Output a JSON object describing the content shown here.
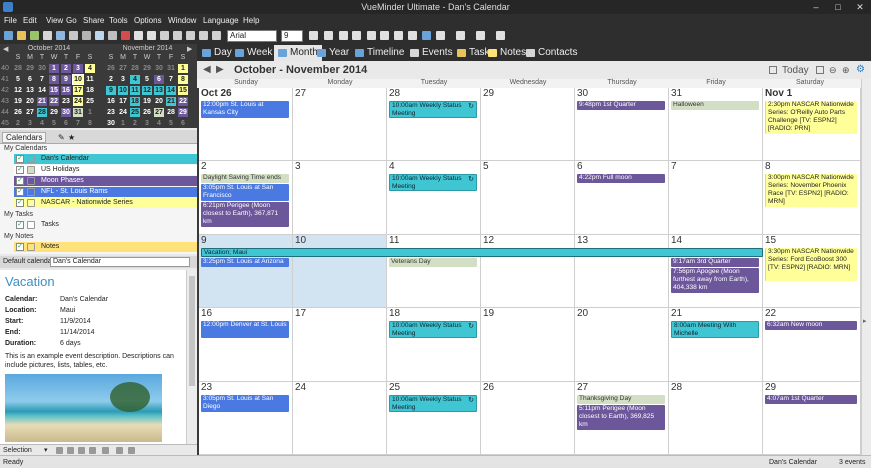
{
  "window": {
    "title": "VueMinder Ultimate - Dan's Calendar"
  },
  "menu": [
    "File",
    "Edit",
    "View",
    "Go",
    "Share",
    "Tools",
    "Options",
    "Window",
    "Language",
    "Help"
  ],
  "toolbar": {
    "font_name": "Arial",
    "font_size": "9"
  },
  "mini_calendars": [
    {
      "title": "October 2014",
      "headers": [
        "S",
        "M",
        "T",
        "W",
        "T",
        "F",
        "S"
      ],
      "rows": [
        {
          "wk": "40",
          "days": [
            "28",
            "29",
            "30",
            "1",
            "2",
            "3",
            "4"
          ]
        },
        {
          "wk": "41",
          "days": [
            "5",
            "6",
            "7",
            "8",
            "9",
            "10",
            "11"
          ]
        },
        {
          "wk": "42",
          "days": [
            "12",
            "13",
            "14",
            "15",
            "16",
            "17",
            "18"
          ]
        },
        {
          "wk": "43",
          "days": [
            "19",
            "20",
            "21",
            "22",
            "23",
            "24",
            "25"
          ]
        },
        {
          "wk": "44",
          "days": [
            "26",
            "27",
            "28",
            "29",
            "30",
            "31",
            "1"
          ]
        },
        {
          "wk": "45",
          "days": [
            "2",
            "3",
            "4",
            "5",
            "6",
            "7",
            "8"
          ]
        }
      ]
    },
    {
      "title": "November 2014",
      "headers": [
        "S",
        "M",
        "T",
        "W",
        "T",
        "F",
        "S"
      ],
      "rows": [
        {
          "wk": "",
          "days": [
            "26",
            "27",
            "28",
            "29",
            "30",
            "31",
            "1"
          ]
        },
        {
          "wk": "",
          "days": [
            "2",
            "3",
            "4",
            "5",
            "6",
            "7",
            "8"
          ]
        },
        {
          "wk": "",
          "days": [
            "9",
            "10",
            "11",
            "12",
            "13",
            "14",
            "15"
          ]
        },
        {
          "wk": "",
          "days": [
            "16",
            "17",
            "18",
            "19",
            "20",
            "21",
            "22"
          ]
        },
        {
          "wk": "",
          "days": [
            "23",
            "24",
            "25",
            "26",
            "27",
            "28",
            "29"
          ]
        },
        {
          "wk": "",
          "days": [
            "30",
            "1",
            "2",
            "3",
            "4",
            "5",
            "6"
          ]
        }
      ]
    }
  ],
  "calendars_panel": {
    "tab": "Calendars",
    "groups": [
      {
        "label": "My Calendars",
        "items": [
          {
            "label": "Dan's Calendar",
            "color": "#3fc6d2"
          },
          {
            "label": "US Holidays",
            "color": "#d3dfc4"
          },
          {
            "label": "Moon Phases",
            "color": "#6c579a"
          },
          {
            "label": "NFL - St. Louis Rams",
            "color": "#4a79e2"
          },
          {
            "label": "NASCAR - Nationwide Series",
            "color": "#ffff99"
          }
        ]
      },
      {
        "label": "My Tasks",
        "items": [
          {
            "label": "Tasks",
            "color": "#ffffff"
          }
        ]
      },
      {
        "label": "My Notes",
        "items": [
          {
            "label": "Notes",
            "color": "#ffe27a"
          }
        ]
      }
    ],
    "default_label": "Default calendar:",
    "default_value": "Dan's Calendar"
  },
  "details": {
    "heading": "Vacation",
    "fields": [
      {
        "k": "Calendar:",
        "v": "Dan's Calendar"
      },
      {
        "k": "Location:",
        "v": "Maui"
      },
      {
        "k": "Start:",
        "v": "11/9/2014"
      },
      {
        "k": "End:",
        "v": "11/14/2014"
      },
      {
        "k": "Duration:",
        "v": "6 days"
      }
    ],
    "description": "This is an example event description. Descriptions can include pictures, lists, tables, etc."
  },
  "selection_label": "Selection",
  "views": [
    "Day",
    "Week",
    "Month",
    "Year",
    "Timeline",
    "Events",
    "Tasks",
    "Notes",
    "Contacts"
  ],
  "active_view": "Month",
  "nav": {
    "range": "October - November 2014",
    "today": "Today"
  },
  "day_names": [
    "Sunday",
    "Monday",
    "Tuesday",
    "Wednesday",
    "Thursday",
    "Friday",
    "Saturday"
  ],
  "weeks": [
    {
      "days": [
        {
          "n": "Oct 26",
          "bold": true,
          "events": [
            {
              "t": "12:00pm St. Louis at Kansas City",
              "c": "blue",
              "h": 2
            }
          ]
        },
        {
          "n": "27",
          "events": []
        },
        {
          "n": "28",
          "events": [
            {
              "t": "10:00am Weekly Status Meeting",
              "c": "teal",
              "h": 2,
              "rec": true
            }
          ]
        },
        {
          "n": "29",
          "events": []
        },
        {
          "n": "30",
          "events": [
            {
              "t": "9:48pm 1st Quarter",
              "c": "purple",
              "h": 1
            }
          ]
        },
        {
          "n": "31",
          "events": [
            {
              "t": "Halloween",
              "c": "green",
              "h": 1
            }
          ]
        },
        {
          "n": "Nov 1",
          "bold": true,
          "events": [
            {
              "t": "2:30pm NASCAR Nationwide Series: O'Reilly Auto Parts Challenge [TV: ESPN2] [RADIO: PRN]",
              "c": "yellow",
              "h": 4
            }
          ]
        }
      ]
    },
    {
      "days": [
        {
          "n": "2",
          "events": [
            {
              "t": "Daylight Saving Time ends",
              "c": "green",
              "h": 1
            },
            {
              "t": "3:05pm St. Louis at San Francisco",
              "c": "blue",
              "h": 2
            },
            {
              "t": "6:21pm Perigee (Moon closest to Earth), 367,871 km",
              "c": "purple",
              "h": 3
            }
          ]
        },
        {
          "n": "3",
          "events": []
        },
        {
          "n": "4",
          "events": [
            {
              "t": "10:00am Weekly Status Meeting",
              "c": "teal",
              "h": 2,
              "rec": true
            }
          ]
        },
        {
          "n": "5",
          "events": []
        },
        {
          "n": "6",
          "events": [
            {
              "t": "4:22pm Full moon",
              "c": "purple",
              "h": 1
            }
          ]
        },
        {
          "n": "7",
          "events": []
        },
        {
          "n": "8",
          "events": [
            {
              "t": "3:00pm NASCAR Nationwide Series: November Phoenix Race [TV: ESPN2] [RADIO: MRN]",
              "c": "yellow",
              "h": 4
            }
          ]
        }
      ]
    },
    {
      "days": [
        {
          "n": "9",
          "hl": true,
          "events": [
            {
              "t": "",
              "c": "spacer",
              "h": 1
            },
            {
              "t": "3:25pm St. Louis at Arizona",
              "c": "blue",
              "h": 1
            }
          ]
        },
        {
          "n": "10",
          "hl": true,
          "events": []
        },
        {
          "n": "11",
          "events": [
            {
              "t": "",
              "c": "spacer",
              "h": 1
            },
            {
              "t": "Veterans Day",
              "c": "green",
              "h": 1
            }
          ]
        },
        {
          "n": "12",
          "events": []
        },
        {
          "n": "13",
          "events": []
        },
        {
          "n": "14",
          "events": [
            {
              "t": "",
              "c": "spacer",
              "h": 1
            },
            {
              "t": "9:17am 3rd Quarter",
              "c": "purple",
              "h": 1
            },
            {
              "t": "7:56pm Apogee (Moon furthest away from Earth), 404,338 km",
              "c": "purple",
              "h": 3
            }
          ]
        },
        {
          "n": "15",
          "events": [
            {
              "t": "3:30pm NASCAR Nationwide Series: Ford EcoBoost 300 [TV: ESPN2] [RADIO: MRN]",
              "c": "yellow",
              "h": 4
            }
          ]
        }
      ]
    },
    {
      "days": [
        {
          "n": "16",
          "events": [
            {
              "t": "12:00pm Denver at St. Louis",
              "c": "blue",
              "h": 2
            }
          ]
        },
        {
          "n": "17",
          "events": []
        },
        {
          "n": "18",
          "events": [
            {
              "t": "10:00am Weekly Status Meeting",
              "c": "teal",
              "h": 2,
              "rec": true
            }
          ]
        },
        {
          "n": "19",
          "events": []
        },
        {
          "n": "20",
          "events": []
        },
        {
          "n": "21",
          "events": [
            {
              "t": "8:00am Meeting With Michelle",
              "c": "teal",
              "h": 2
            }
          ]
        },
        {
          "n": "22",
          "events": [
            {
              "t": "6:32am New moon",
              "c": "purple",
              "h": 1
            }
          ]
        }
      ]
    },
    {
      "days": [
        {
          "n": "23",
          "events": [
            {
              "t": "3:05pm St. Louis at San Diego",
              "c": "blue",
              "h": 2
            }
          ]
        },
        {
          "n": "24",
          "events": []
        },
        {
          "n": "25",
          "events": [
            {
              "t": "10:00am Weekly Status Meeting",
              "c": "teal",
              "h": 2,
              "rec": true
            }
          ]
        },
        {
          "n": "26",
          "events": []
        },
        {
          "n": "27",
          "events": [
            {
              "t": "Thanksgiving Day",
              "c": "green",
              "h": 1
            },
            {
              "t": "5:11pm Perigee (Moon closest to Earth), 369,825 km",
              "c": "purple",
              "h": 3
            }
          ]
        },
        {
          "n": "28",
          "events": []
        },
        {
          "n": "29",
          "events": [
            {
              "t": "4:07am 1st Quarter",
              "c": "purple",
              "h": 1
            }
          ]
        }
      ]
    }
  ],
  "vacation_banner": "Vacation; Maui",
  "status": {
    "left": "Ready",
    "calendar": "Dan's Calendar",
    "count": "3 events"
  }
}
